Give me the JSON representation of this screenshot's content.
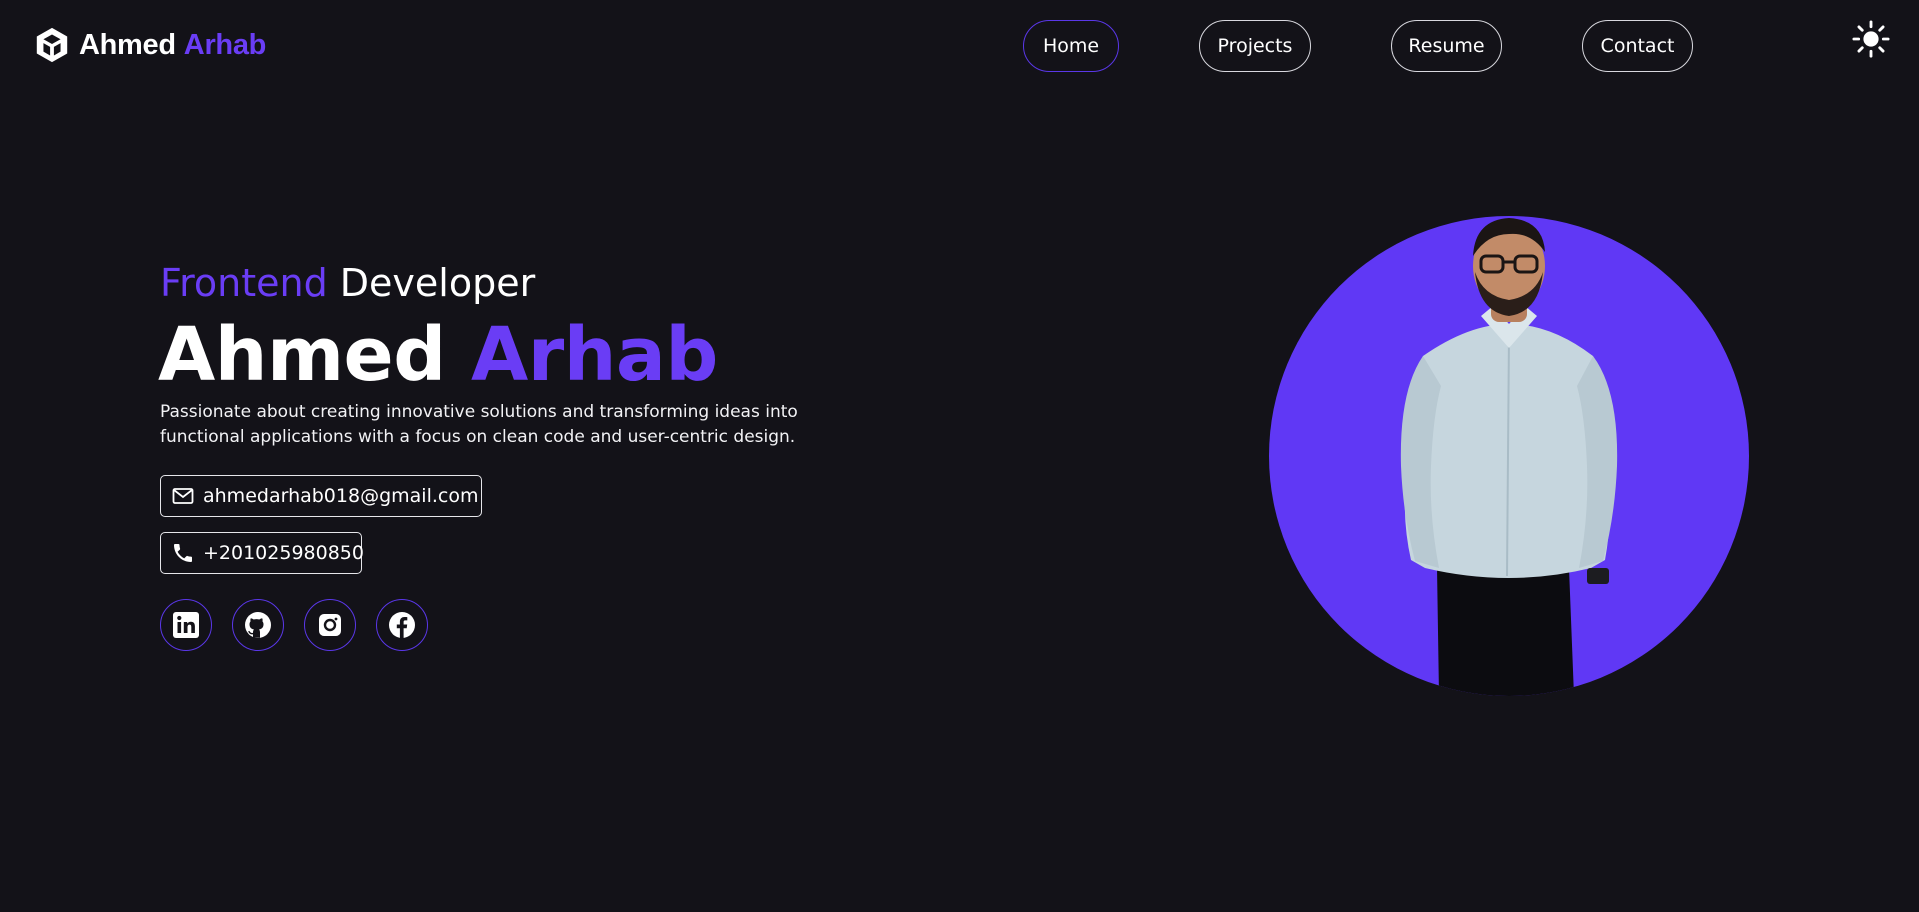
{
  "header": {
    "logo": {
      "first": "Ahmed",
      "last": "Arhab",
      "icon": "cube-logo-icon"
    },
    "nav": [
      {
        "label": "Home",
        "active": true
      },
      {
        "label": "Projects",
        "active": false
      },
      {
        "label": "Resume",
        "active": false
      },
      {
        "label": "Contact",
        "active": false
      }
    ],
    "theme_toggle_icon": "sun-icon"
  },
  "hero": {
    "role_accent": "Frontend",
    "role_rest": "Developer",
    "name_first": "Ahmed",
    "name_last": "Arhab",
    "description": "Passionate about creating innovative solutions and transforming ideas into functional applications with a focus on clean code and user-centric design.",
    "email": "ahmedarhab018@gmail.com",
    "phone": "+201025980850",
    "socials": [
      "linkedin-icon",
      "github-icon",
      "instagram-icon",
      "facebook-icon"
    ]
  },
  "colors": {
    "background": "#131218",
    "accent": "#6a3df5",
    "text": "#ffffff"
  }
}
